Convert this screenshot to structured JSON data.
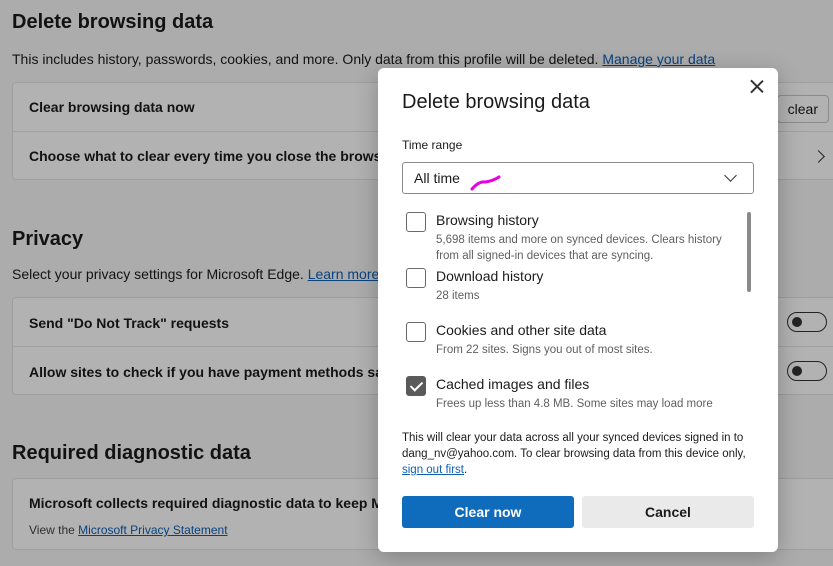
{
  "settings": {
    "delete_section": {
      "title": "Delete browsing data",
      "description": "This includes history, passwords, cookies, and more. Only data from this profile will be deleted.",
      "manage_link": "Manage your data",
      "clear_now_row": "Clear browsing data now",
      "clear_button_partial": "clear",
      "choose_row": "Choose what to clear every time you close the browser"
    },
    "privacy_section": {
      "title": "Privacy",
      "description": "Select your privacy settings for Microsoft Edge.",
      "learn_more_link": "Learn more",
      "do_not_track_row": "Send \"Do Not Track\" requests",
      "payment_row": "Allow sites to check if you have payment methods save",
      "do_not_track_on": false,
      "payment_on": false
    },
    "diagnostic_section": {
      "title": "Required diagnostic data",
      "row": "Microsoft collects required diagnostic data to keep Mic",
      "sub_prefix": "View the",
      "sub_link": "Microsoft Privacy Statement"
    }
  },
  "dialog": {
    "title": "Delete browsing data",
    "time_range_label": "Time range",
    "time_range_value": "All time",
    "items": [
      {
        "label": "Browsing history",
        "description": "5,698 items and more on synced devices. Clears history from all signed-in devices that are syncing.",
        "checked": false
      },
      {
        "label": "Download history",
        "description": "28 items",
        "checked": false
      },
      {
        "label": "Cookies and other site data",
        "description": "From 22 sites. Signs you out of most sites.",
        "checked": false
      },
      {
        "label": "Cached images and files",
        "description": "Frees up less than 4.8 MB. Some sites may load more",
        "checked": true
      }
    ],
    "notice_text": "This will clear your data across all your synced devices signed in to dang_nv@yahoo.com. To clear browsing data from this device only,",
    "notice_link": "sign out first",
    "notice_end": ".",
    "clear_now_label": "Clear now",
    "cancel_label": "Cancel"
  },
  "colors": {
    "primary": "#0f6cbd",
    "link": "#0f5fb3",
    "annotation": "#e600e6"
  }
}
